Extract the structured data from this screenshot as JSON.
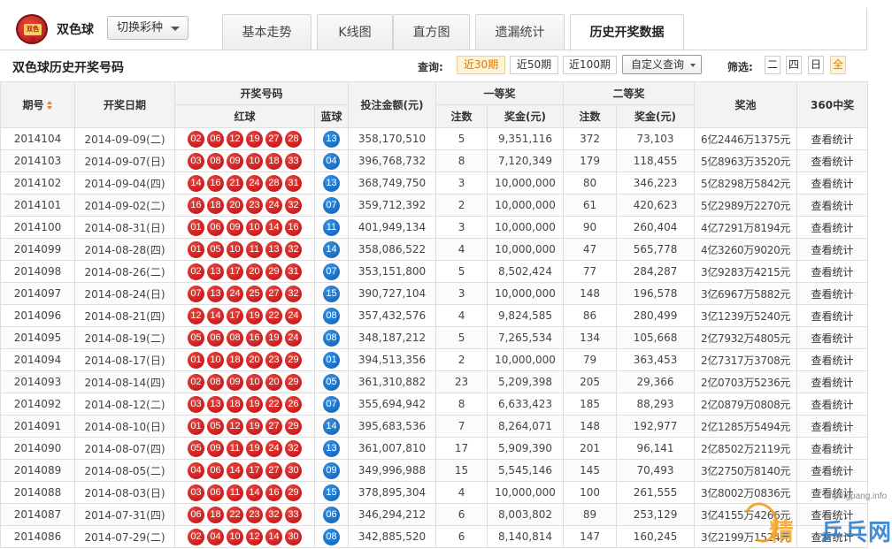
{
  "app": {
    "title": "双色球",
    "logo_text": "双色球",
    "switch_label": "切换彩种"
  },
  "tabs": [
    {
      "label": "基本走势",
      "active": false
    },
    {
      "label": "K线图",
      "active": false
    },
    {
      "label": "直方图",
      "active": false
    },
    {
      "label": "遗漏统计",
      "active": false
    },
    {
      "label": "历史开奖数据",
      "active": true
    }
  ],
  "subheader": {
    "title": "双色球历史开奖号码",
    "query_label": "查询:",
    "query_buttons": [
      {
        "label": "近30期",
        "active": true
      },
      {
        "label": "近50期",
        "active": false
      },
      {
        "label": "近100期",
        "active": false
      }
    ],
    "custom_query": "自定义查询",
    "filter_label": "筛选:",
    "filter_buttons": [
      {
        "label": "二",
        "active": false
      },
      {
        "label": "四",
        "active": false
      },
      {
        "label": "日",
        "active": false
      },
      {
        "label": "全",
        "active": true
      }
    ]
  },
  "table": {
    "headers": {
      "issue": "期号",
      "date": "开奖日期",
      "numbers": "开奖号码",
      "red": "红球",
      "blue": "蓝球",
      "sales": "投注金额(元)",
      "first": "一等奖",
      "second": "二等奖",
      "count": "注数",
      "prize": "奖金(元)",
      "pool": "奖池",
      "stats": "360中奖"
    },
    "link_label": "查看统计",
    "rows": [
      {
        "issue": "2014104",
        "date": "2014-09-09(二)",
        "red": [
          "02",
          "06",
          "12",
          "19",
          "27",
          "28"
        ],
        "blue": "13",
        "sales": "358,170,510",
        "first_count": "5",
        "first_prize": "9,351,116",
        "second_count": "372",
        "second_prize": "73,103",
        "pool": "6亿2446万1375元"
      },
      {
        "issue": "2014103",
        "date": "2014-09-07(日)",
        "red": [
          "03",
          "08",
          "09",
          "10",
          "18",
          "33"
        ],
        "blue": "04",
        "sales": "396,768,732",
        "first_count": "8",
        "first_prize": "7,120,349",
        "second_count": "179",
        "second_prize": "118,455",
        "pool": "5亿8963万3520元"
      },
      {
        "issue": "2014102",
        "date": "2014-09-04(四)",
        "red": [
          "14",
          "16",
          "21",
          "24",
          "28",
          "31"
        ],
        "blue": "13",
        "sales": "368,749,750",
        "first_count": "3",
        "first_prize": "10,000,000",
        "second_count": "80",
        "second_prize": "346,223",
        "pool": "5亿8298万5842元"
      },
      {
        "issue": "2014101",
        "date": "2014-09-02(二)",
        "red": [
          "16",
          "18",
          "20",
          "23",
          "24",
          "32"
        ],
        "blue": "07",
        "sales": "359,712,392",
        "first_count": "2",
        "first_prize": "10,000,000",
        "second_count": "61",
        "second_prize": "420,623",
        "pool": "5亿2989万2270元"
      },
      {
        "issue": "2014100",
        "date": "2014-08-31(日)",
        "red": [
          "01",
          "06",
          "09",
          "10",
          "14",
          "16"
        ],
        "blue": "11",
        "sales": "401,949,134",
        "first_count": "3",
        "first_prize": "10,000,000",
        "second_count": "90",
        "second_prize": "260,404",
        "pool": "4亿7291万8194元"
      },
      {
        "issue": "2014099",
        "date": "2014-08-28(四)",
        "red": [
          "01",
          "05",
          "10",
          "11",
          "13",
          "32"
        ],
        "blue": "14",
        "sales": "358,086,522",
        "first_count": "4",
        "first_prize": "10,000,000",
        "second_count": "47",
        "second_prize": "565,778",
        "pool": "4亿3260万9020元"
      },
      {
        "issue": "2014098",
        "date": "2014-08-26(二)",
        "red": [
          "02",
          "13",
          "17",
          "20",
          "29",
          "31"
        ],
        "blue": "07",
        "sales": "353,151,800",
        "first_count": "5",
        "first_prize": "8,502,424",
        "second_count": "77",
        "second_prize": "284,287",
        "pool": "3亿9283万4215元"
      },
      {
        "issue": "2014097",
        "date": "2014-08-24(日)",
        "red": [
          "07",
          "13",
          "24",
          "25",
          "27",
          "32"
        ],
        "blue": "15",
        "sales": "390,727,104",
        "first_count": "3",
        "first_prize": "10,000,000",
        "second_count": "148",
        "second_prize": "196,578",
        "pool": "3亿6967万5882元"
      },
      {
        "issue": "2014096",
        "date": "2014-08-21(四)",
        "red": [
          "12",
          "14",
          "17",
          "19",
          "22",
          "24"
        ],
        "blue": "08",
        "sales": "357,432,576",
        "first_count": "4",
        "first_prize": "9,824,585",
        "second_count": "86",
        "second_prize": "280,499",
        "pool": "3亿1239万5240元"
      },
      {
        "issue": "2014095",
        "date": "2014-08-19(二)",
        "red": [
          "05",
          "06",
          "08",
          "16",
          "19",
          "24"
        ],
        "blue": "08",
        "sales": "348,187,212",
        "first_count": "5",
        "first_prize": "7,265,534",
        "second_count": "134",
        "second_prize": "105,668",
        "pool": "2亿7932万4805元"
      },
      {
        "issue": "2014094",
        "date": "2014-08-17(日)",
        "red": [
          "01",
          "10",
          "18",
          "20",
          "23",
          "29"
        ],
        "blue": "01",
        "sales": "394,513,356",
        "first_count": "2",
        "first_prize": "10,000,000",
        "second_count": "79",
        "second_prize": "363,453",
        "pool": "2亿7317万3708元"
      },
      {
        "issue": "2014093",
        "date": "2014-08-14(四)",
        "red": [
          "02",
          "08",
          "09",
          "10",
          "20",
          "29"
        ],
        "blue": "05",
        "sales": "361,310,882",
        "first_count": "23",
        "first_prize": "5,209,398",
        "second_count": "205",
        "second_prize": "29,366",
        "pool": "2亿0703万5236元"
      },
      {
        "issue": "2014092",
        "date": "2014-08-12(二)",
        "red": [
          "03",
          "13",
          "18",
          "19",
          "22",
          "26"
        ],
        "blue": "07",
        "sales": "355,694,942",
        "first_count": "8",
        "first_prize": "6,633,423",
        "second_count": "185",
        "second_prize": "88,293",
        "pool": "2亿0879万0808元"
      },
      {
        "issue": "2014091",
        "date": "2014-08-10(日)",
        "red": [
          "01",
          "05",
          "12",
          "19",
          "27",
          "29"
        ],
        "blue": "14",
        "sales": "395,683,536",
        "first_count": "7",
        "first_prize": "8,264,071",
        "second_count": "148",
        "second_prize": "192,977",
        "pool": "2亿1285万5494元"
      },
      {
        "issue": "2014090",
        "date": "2014-08-07(四)",
        "red": [
          "05",
          "09",
          "11",
          "19",
          "24",
          "32"
        ],
        "blue": "13",
        "sales": "361,007,810",
        "first_count": "17",
        "first_prize": "5,909,390",
        "second_count": "201",
        "second_prize": "96,141",
        "pool": "2亿8502万2119元"
      },
      {
        "issue": "2014089",
        "date": "2014-08-05(二)",
        "red": [
          "04",
          "06",
          "14",
          "17",
          "27",
          "30"
        ],
        "blue": "09",
        "sales": "349,996,988",
        "first_count": "15",
        "first_prize": "5,545,146",
        "second_count": "145",
        "second_prize": "70,493",
        "pool": "3亿2750万8140元"
      },
      {
        "issue": "2014088",
        "date": "2014-08-03(日)",
        "red": [
          "03",
          "06",
          "11",
          "14",
          "16",
          "29"
        ],
        "blue": "15",
        "sales": "378,895,304",
        "first_count": "4",
        "first_prize": "10,000,000",
        "second_count": "100",
        "second_prize": "261,555",
        "pool": "3亿8002万0836元"
      },
      {
        "issue": "2014087",
        "date": "2014-07-31(四)",
        "red": [
          "06",
          "18",
          "22",
          "23",
          "32",
          "33"
        ],
        "blue": "06",
        "sales": "346,294,212",
        "first_count": "6",
        "first_prize": "8,003,802",
        "second_count": "89",
        "second_prize": "253,129",
        "pool": "3亿4155万4266元"
      },
      {
        "issue": "2014086",
        "date": "2014-07-29(二)",
        "red": [
          "02",
          "04",
          "10",
          "12",
          "14",
          "30"
        ],
        "blue": "08",
        "sales": "342,885,520",
        "first_count": "6",
        "first_prize": "8,140,814",
        "second_count": "147",
        "second_prize": "160,245",
        "pool": "3亿2199万1524元"
      }
    ]
  },
  "watermark": {
    "domain": "anpingpang.info",
    "brand": "乒乓网",
    "prefix": "精"
  }
}
